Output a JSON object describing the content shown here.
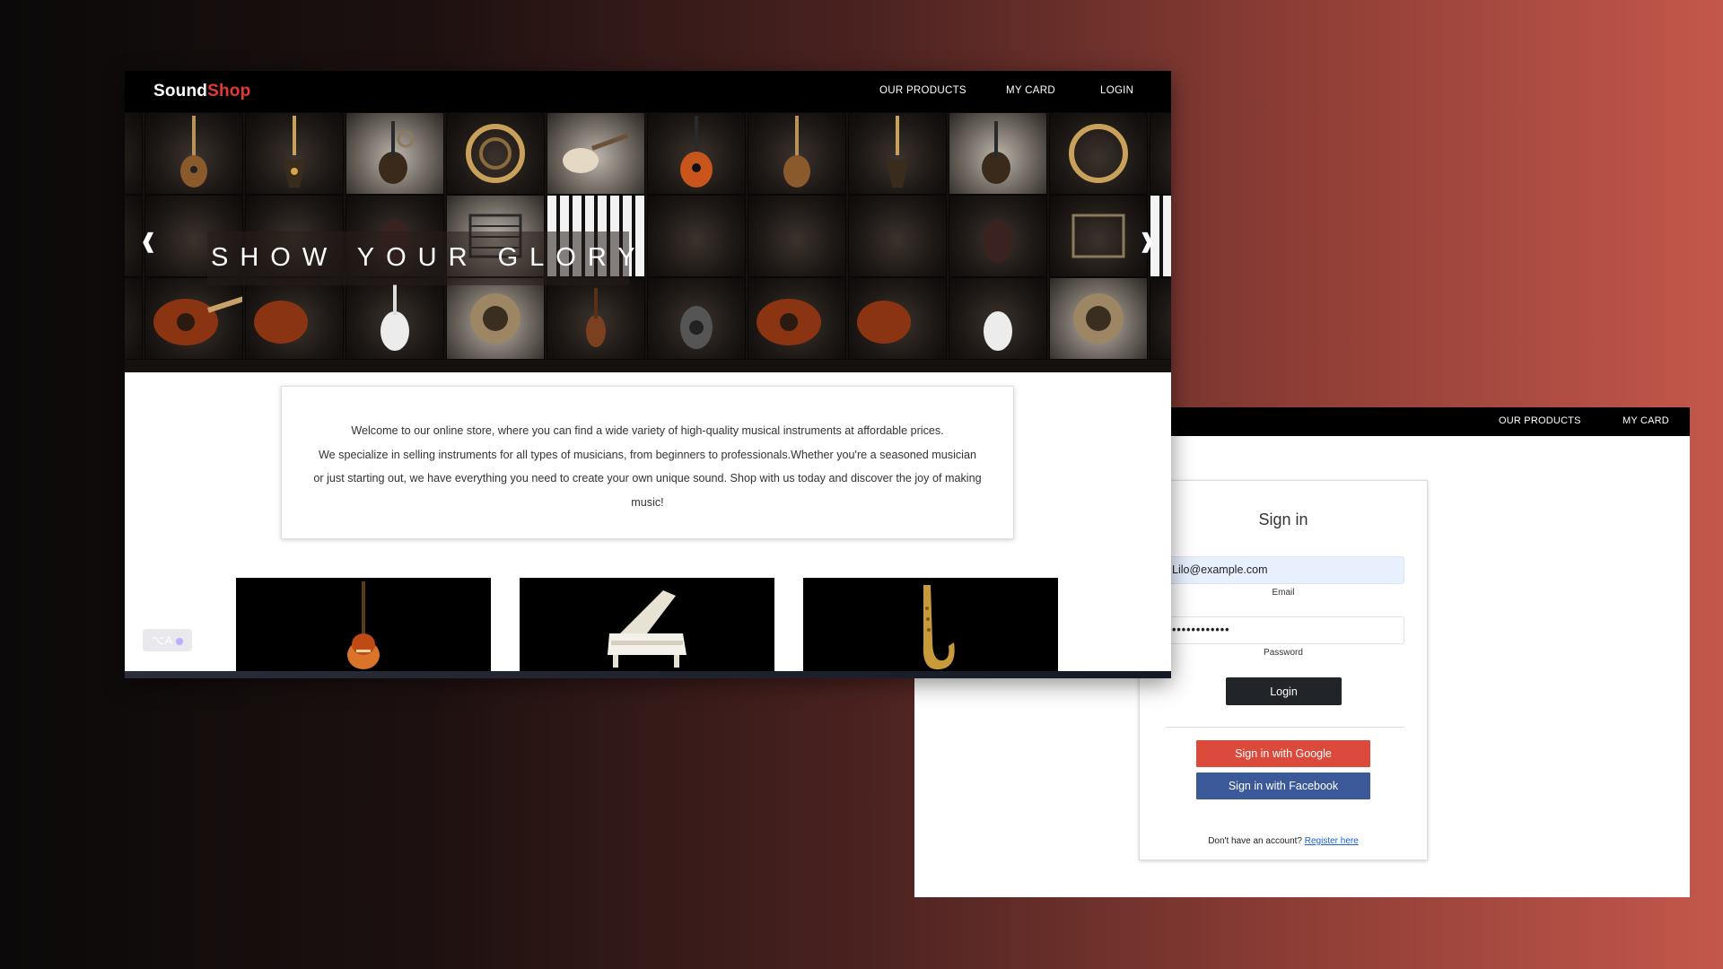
{
  "login_page": {
    "nav": {
      "products": "OUR PRODUCTS",
      "card": "MY CARD"
    },
    "signin": {
      "title": "Sign in",
      "email_value": "Lilo@example.com",
      "email_label": "Email",
      "password_value": "••••••••••••",
      "password_label": "Password",
      "login_button": "Login",
      "google_button": "Sign in with Google",
      "facebook_button": "Sign in with Facebook",
      "register_prompt": "Don't have an account?",
      "register_link": "Register here"
    },
    "colors": {
      "google": "#db4a3b",
      "facebook": "#3b5998",
      "login": "#212529"
    }
  },
  "home_page": {
    "logo": {
      "part1": "Sound",
      "part2": "Shop"
    },
    "nav": {
      "products": "OUR PRODUCTS",
      "card": "MY CARD",
      "login": "LOGIN"
    },
    "hero": {
      "slogan": "SHOW YOUR GLORY",
      "prev_arrow": "❰",
      "next_arrow": "❱"
    },
    "intro": {
      "line1": "Welcome to our online store, where you can find a wide variety of high-quality musical instruments at affordable prices.",
      "line2": "We specialize in selling instruments for all types of musicians, from beginners to professionals.Whether you're a seasoned musician",
      "line3": "or just starting out, we have everything you need to create your own unique sound. Shop with us today and discover the joy of making",
      "line4": "music!"
    },
    "products": [
      {
        "icon": "electric-guitar-image"
      },
      {
        "icon": "grand-piano-image"
      },
      {
        "icon": "saxophone-image"
      }
    ],
    "translate_button": "⌥A",
    "colors": {
      "logo_accent": "#e53935",
      "nav_bg": "#000000"
    }
  }
}
